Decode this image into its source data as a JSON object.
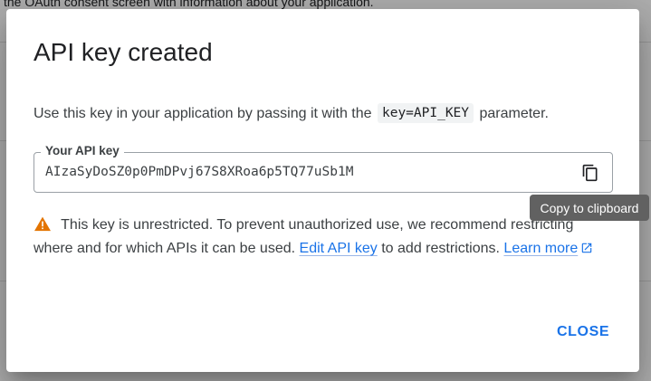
{
  "background": {
    "partial_text": "the OAuth consent screen with information about your application."
  },
  "dialog": {
    "title": "API key created",
    "instructions_before": "Use this key in your application by passing it with the",
    "instructions_code": "key=API_KEY",
    "instructions_after": "parameter.",
    "field": {
      "label": "Your API key",
      "value": "AIzaSyDoSZ0p0PmDPvj67S8XRoa6p5TQ77uSb1M",
      "copy_icon": "copy-icon"
    },
    "warning": {
      "icon": "warning-icon",
      "text_before": "This key is unrestricted. To prevent unauthorized use, we recommend restricting where and for which APIs it can be used.",
      "edit_link": "Edit API key",
      "text_middle": "to add restrictions.",
      "learn_link": "Learn more",
      "learn_icon": "open-in-new-icon"
    },
    "close_label": "CLOSE"
  },
  "tooltip": {
    "text": "Copy to clipboard"
  },
  "colors": {
    "accent": "#1a73e8",
    "warning": "#e37400",
    "tooltip_bg": "#616161"
  }
}
